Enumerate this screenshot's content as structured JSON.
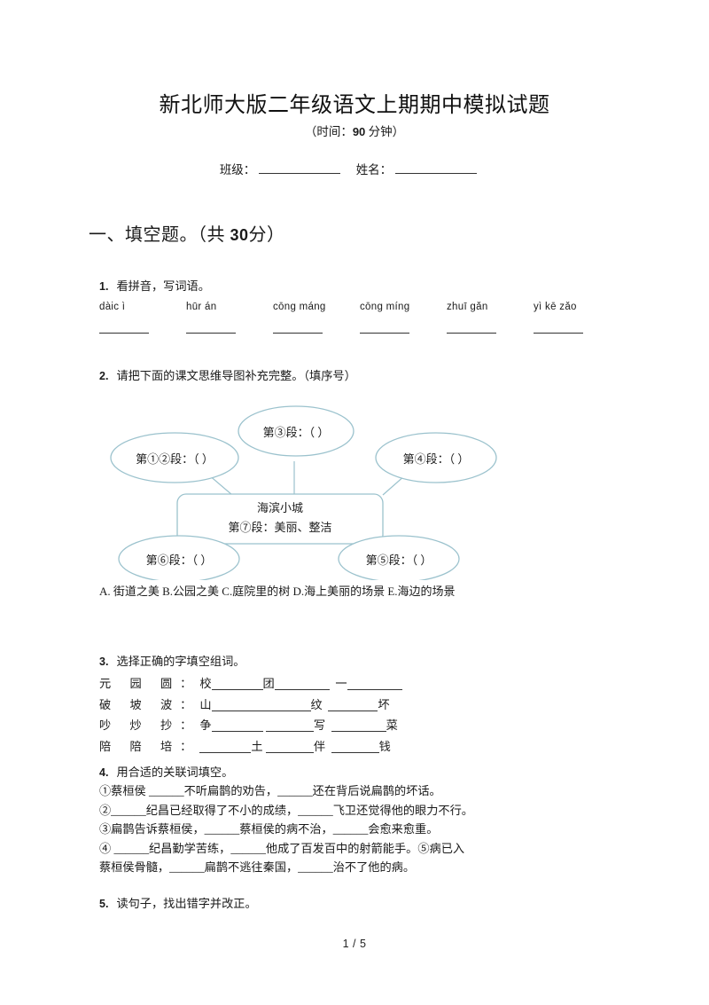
{
  "header": {
    "title": "新北师大版二年级语文上期期中模拟试题",
    "subtitle_prefix": "（时间：",
    "subtitle_number": "90",
    "subtitle_suffix": "分钟）",
    "class_label": "班级：",
    "name_label": "姓名："
  },
  "section": {
    "label_prefix": "一、填空题。（共",
    "score": "30",
    "label_suffix": "分）"
  },
  "q1": {
    "number": "1.",
    "title": "看拼音，写词语。",
    "pinyin": [
      "dàic ì",
      "hūr án",
      "cōng máng",
      "cōng míng",
      "zhuī gǎn",
      "yì kē zǎo"
    ]
  },
  "q2": {
    "number": "2.",
    "title": "请把下面的课文思维导图补充完整。（填序号）",
    "diagram": {
      "center_line1": "海滨小城",
      "center_line2": "第⑦段：美丽、整洁",
      "nodes": [
        {
          "id": "n3",
          "label": "第③段：（    ）"
        },
        {
          "id": "n12",
          "label": "第①②段：（    ）"
        },
        {
          "id": "n4",
          "label": "第④段：（    ）"
        },
        {
          "id": "n6",
          "label": "第⑥段：（    ）"
        },
        {
          "id": "n5",
          "label": "第⑤段：（    ）"
        }
      ],
      "stroke_color": "#9bc2cd"
    },
    "options": "A. 街道之美 B.公园之美 C.庭院里的树 D.海上美丽的场景 E.海边的场景"
  },
  "q3": {
    "number": "3.",
    "title": "选择正确的字填空组词。",
    "rows": [
      {
        "chars": "元 园 圆：",
        "parts": [
          "校",
          "团",
          "一"
        ]
      },
      {
        "chars": "破 坡 波：",
        "parts": [
          "山",
          "纹",
          "坏"
        ]
      },
      {
        "chars": "吵 炒 抄：",
        "parts": [
          "争",
          "写",
          "菜"
        ]
      },
      {
        "chars": "陪 陪 培：",
        "parts": [
          "土",
          "伴",
          "钱"
        ]
      }
    ]
  },
  "q4": {
    "number": "4.",
    "title": "用合适的关联词填空。",
    "items": [
      "①蔡桓侯 ______不听扁鹊的劝告，______还在背后说扁鹊的坏话。",
      "②______纪昌已经取得了不小的成绩，______飞卫还觉得他的眼力不行。",
      "③扁鹊告诉蔡桓侯，______蔡桓侯的病不治，______会愈来愈重。",
      "④ ______纪昌勤学苦练，______他成了百发百中的射箭能手。⑤病已入",
      "蔡桓侯骨髓，______扁鹊不逃往秦国，______治不了他的病。"
    ]
  },
  "q5": {
    "number": "5.",
    "title": "读句子，找出错字并改正。"
  },
  "footer": {
    "page": "1 / 5"
  }
}
